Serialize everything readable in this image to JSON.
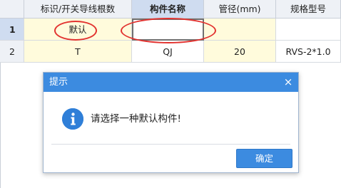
{
  "grid": {
    "columns": [
      "",
      "标识/开关导线根数",
      "构件名称",
      "管径(mm)",
      "规格型号"
    ],
    "rows": [
      {
        "num": "1",
        "cells": [
          "默认",
          "",
          "",
          ""
        ]
      },
      {
        "num": "2",
        "cells": [
          "T",
          "QJ",
          "20",
          "RVS-2*1.0"
        ]
      }
    ]
  },
  "dialog": {
    "title": "提示",
    "close_icon": "×",
    "message": "请选择一种默认构件!",
    "ok_label": "确定",
    "icon": "info-icon"
  },
  "colors": {
    "accent_blue": "#3c8be0",
    "annotation_red": "#e2322f",
    "row_yellow": "#fffbdc"
  }
}
